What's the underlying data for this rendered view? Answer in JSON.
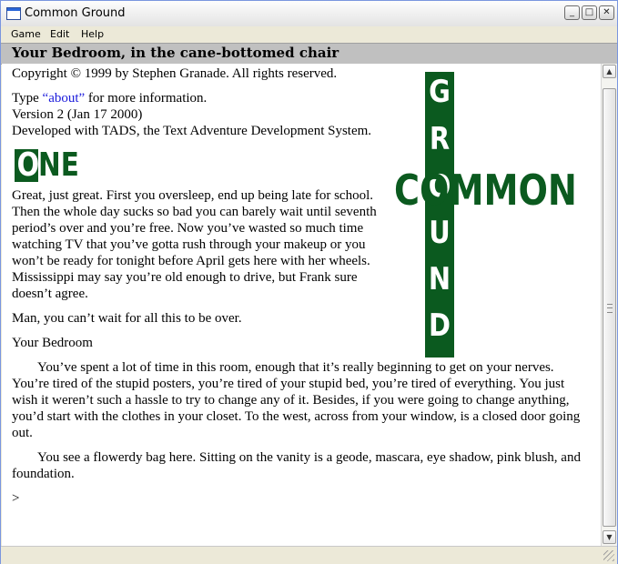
{
  "window": {
    "title": "Common Ground",
    "minimize_glyph": "_",
    "maximize_glyph": "□",
    "close_glyph": "✕"
  },
  "menu": {
    "items": [
      "Game",
      "Edit",
      "Help"
    ]
  },
  "status_line": {
    "location": "Your Bedroom, in the cane-bottomed chair"
  },
  "transcript": {
    "copyright": "Copyright © 1999 by Stephen Granade. All rights reserved.",
    "type_prefix": "Type ",
    "about_link": "“about”",
    "type_suffix": " for more information.",
    "version": "Version 2 (Jan 17 2000)",
    "developed": "Developed with TADS, the Text Adventure Development System.",
    "chapter_first_letter": "O",
    "chapter_rest": "NE",
    "intro": "Great, just great. First you oversleep, end up being late for school. Then the whole day sucks so bad you can barely wait until seventh period’s over and you’re free. Now you’ve wasted so much time watching TV that you’ve gotta rush through your makeup or you won’t be ready for tonight before April gets here with her wheels. Mississippi may say you’re old enough to drive, but Frank sure doesn’t agree.",
    "wait_line": "Man, you can’t wait for all this to be over.",
    "room_name": "Your Bedroom",
    "room_description": "You’ve spent a lot of time in this room, enough that it’s really beginning to get on your nerves. You’re tired of the stupid posters, you’re tired of your stupid bed, you’re tired of everything. You just wish it weren’t such a hassle to try to change any of it. Besides, if you were going to change anything, you’d start with the clothes in your closet. To the west, across from your window, is a closed door going out.",
    "room_objects": "You see a flowerdy bag here. Sitting on the vanity is a geode, mascara, eye shadow, pink blush, and foundation.",
    "prompt": ">"
  },
  "logo": {
    "vertical_letters": [
      "G",
      "R",
      "O",
      "U",
      "N",
      "D"
    ],
    "horizontal_word": "COMMON",
    "color": "#0b5a1f"
  },
  "scrollbar": {
    "up_glyph": "▲",
    "down_glyph": "▼"
  }
}
